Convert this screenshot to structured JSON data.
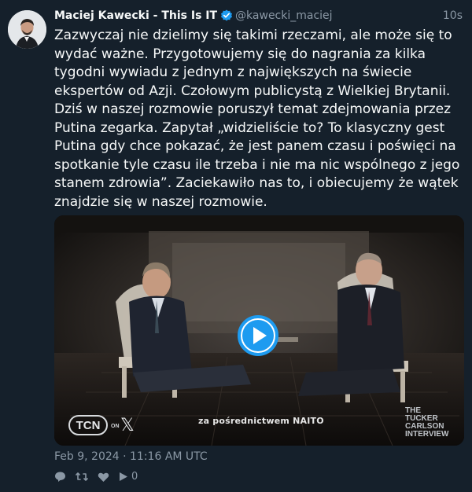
{
  "tweet": {
    "author_name": "Maciej Kawecki - This Is IT",
    "handle": "@kawecki_maciej",
    "time_ago": "10s",
    "text": "Zazwyczaj nie dzielimy się takimi rzeczami, ale może się to wydać ważne. Przygotowujemy się do nagrania za kilka tygodni wywiadu z jednym z największych na świecie ekspertów od Azji. Czołowym publicystą z Wielkiej Brytanii. Dziś w naszej rozmowie poruszył temat zdejmowania przez Putina zegarka. Zapytał „widzieliście to? To klasyczny gest Putina gdy chce pokazać, że jest panem czasu i poświęci na spotkanie tyle czasu ile trzeba i nie ma nic wspólnego z jego stanem zdrowia”. Zaciekawiło nas to, i obiecujemy że wątek znajdzie się w naszej rozmowie.",
    "date": "Feb 9, 2024 · 11:16 AM UTC",
    "views_count": "0"
  },
  "video": {
    "caption": "za pośrednictwem NAITO",
    "logo_left": "TCN",
    "logo_left_on": "ON",
    "logo_left_x": "𝕏",
    "logo_right_line1": "THE",
    "logo_right_line2": "TUCKER",
    "logo_right_line3": "CARLSON",
    "logo_right_line4": "INTERVIEW"
  },
  "colors": {
    "background": "#15202b",
    "text": "#f7f9f9",
    "secondary": "#8b98a5",
    "verified": "#1d9bf0",
    "play": "#1d9bf0"
  },
  "icons": [
    "verified-badge-icon",
    "reply-icon",
    "retweet-icon",
    "like-icon",
    "views-icon",
    "play-icon"
  ]
}
